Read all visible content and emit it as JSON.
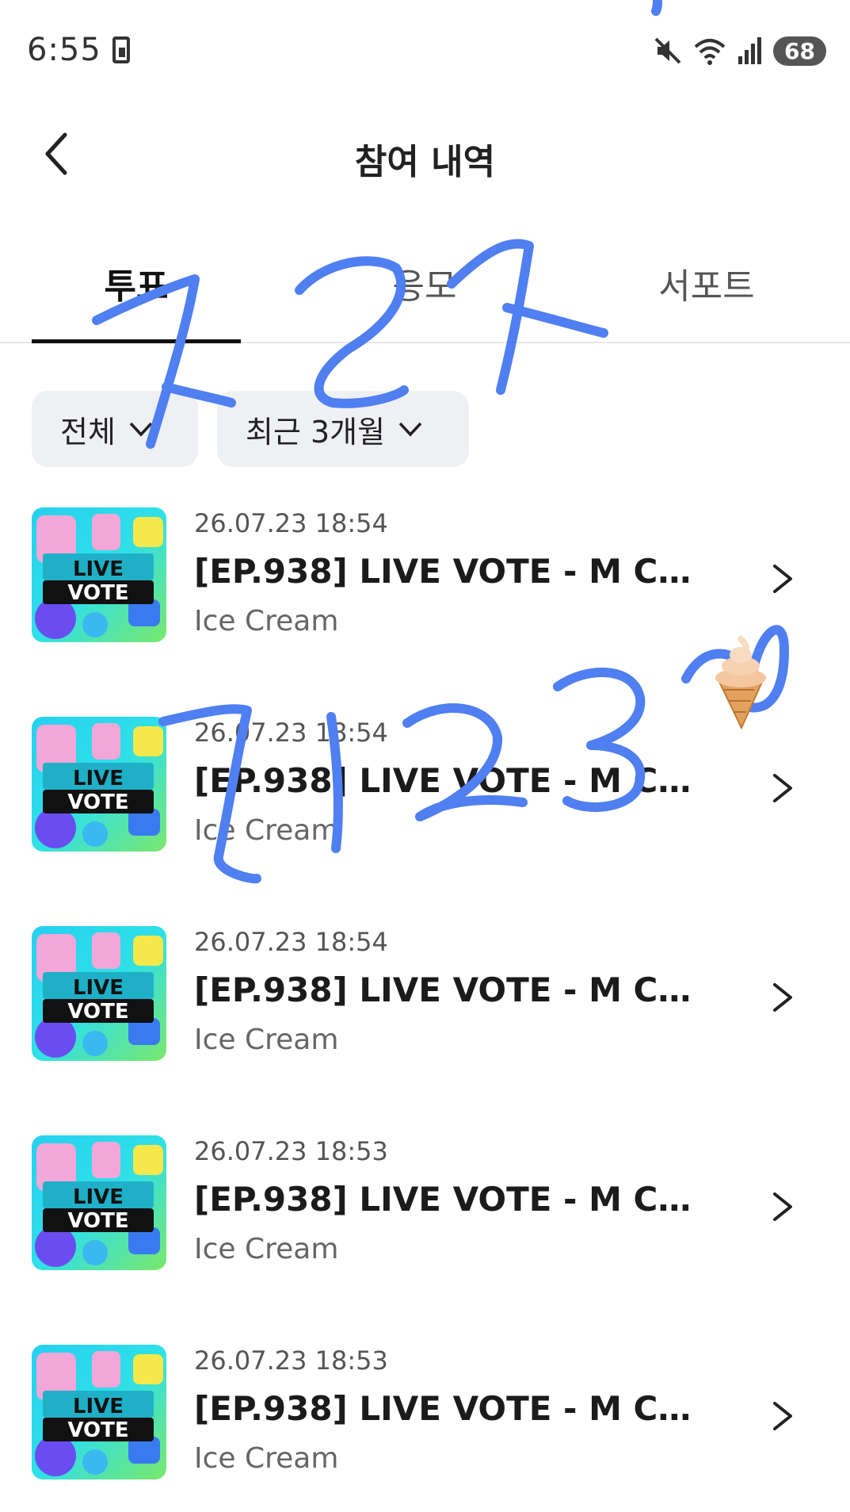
{
  "status_bar": {
    "time": "6:55",
    "battery": "68",
    "icons": [
      "sim-icon",
      "mute-icon",
      "wifi-icon",
      "signal-icon",
      "battery-icon"
    ]
  },
  "header": {
    "title": "참여 내역",
    "back_icon": "chevron-left-icon"
  },
  "tabs": [
    {
      "label": "투표",
      "active": true
    },
    {
      "label": "응모",
      "active": false
    },
    {
      "label": "서포트",
      "active": false
    }
  ],
  "filters": [
    {
      "label": "전체"
    },
    {
      "label": "최근 3개월"
    }
  ],
  "items": [
    {
      "date": "26.07.23 18:54",
      "title": "[EP.938] LIVE VOTE - M CO...",
      "subtitle": "Ice Cream",
      "thumb_text": [
        "LIVE",
        "VOTE"
      ]
    },
    {
      "date": "26.07.23 18:54",
      "title": "[EP.938] LIVE VOTE - M CO...",
      "subtitle": "Ice Cream",
      "thumb_text": [
        "LIVE",
        "VOTE"
      ]
    },
    {
      "date": "26.07.23 18:54",
      "title": "[EP.938] LIVE VOTE - M CO...",
      "subtitle": "Ice Cream",
      "thumb_text": [
        "LIVE",
        "VOTE"
      ]
    },
    {
      "date": "26.07.23 18:53",
      "title": "[EP.938] LIVE VOTE - M CO...",
      "subtitle": "Ice Cream",
      "thumb_text": [
        "LIVE",
        "VOTE"
      ]
    },
    {
      "date": "26.07.23 18:53",
      "title": "[EP.938] LIVE VOTE - M CO...",
      "subtitle": "Ice Cream",
      "thumb_text": [
        "LIVE",
        "VOTE"
      ]
    }
  ],
  "colors": {
    "scribble": "#4f7ff0",
    "chip_bg": "#eef0f4",
    "underline": "#111111"
  }
}
